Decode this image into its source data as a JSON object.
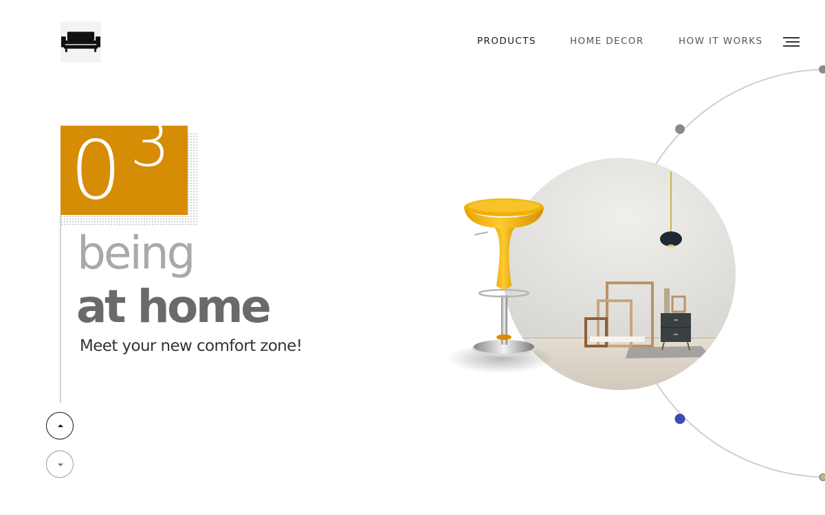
{
  "brand": {
    "logo_icon": "sofa-icon"
  },
  "nav": {
    "items": [
      {
        "label": "PRODUCTS",
        "active": true
      },
      {
        "label": "HOME DECOR",
        "active": false
      },
      {
        "label": "HOW IT WORKS",
        "active": false
      }
    ],
    "menu_icon": "hamburger-menu-icon"
  },
  "slide": {
    "number_first_digit": "0",
    "number_second_digit": "3",
    "title_line1": "being",
    "title_line2": "at home",
    "tagline": "Meet your new comfort zone!"
  },
  "controls": {
    "up_icon": "arrow-up-icon",
    "down_icon": "arrow-down-icon"
  },
  "colors": {
    "accent": "#d68c05",
    "active_dot": "#3d4ab8",
    "inactive_dot": "#8a8a8a",
    "title_light": "#a9a9a9",
    "title_dark": "#6a6a6a"
  }
}
